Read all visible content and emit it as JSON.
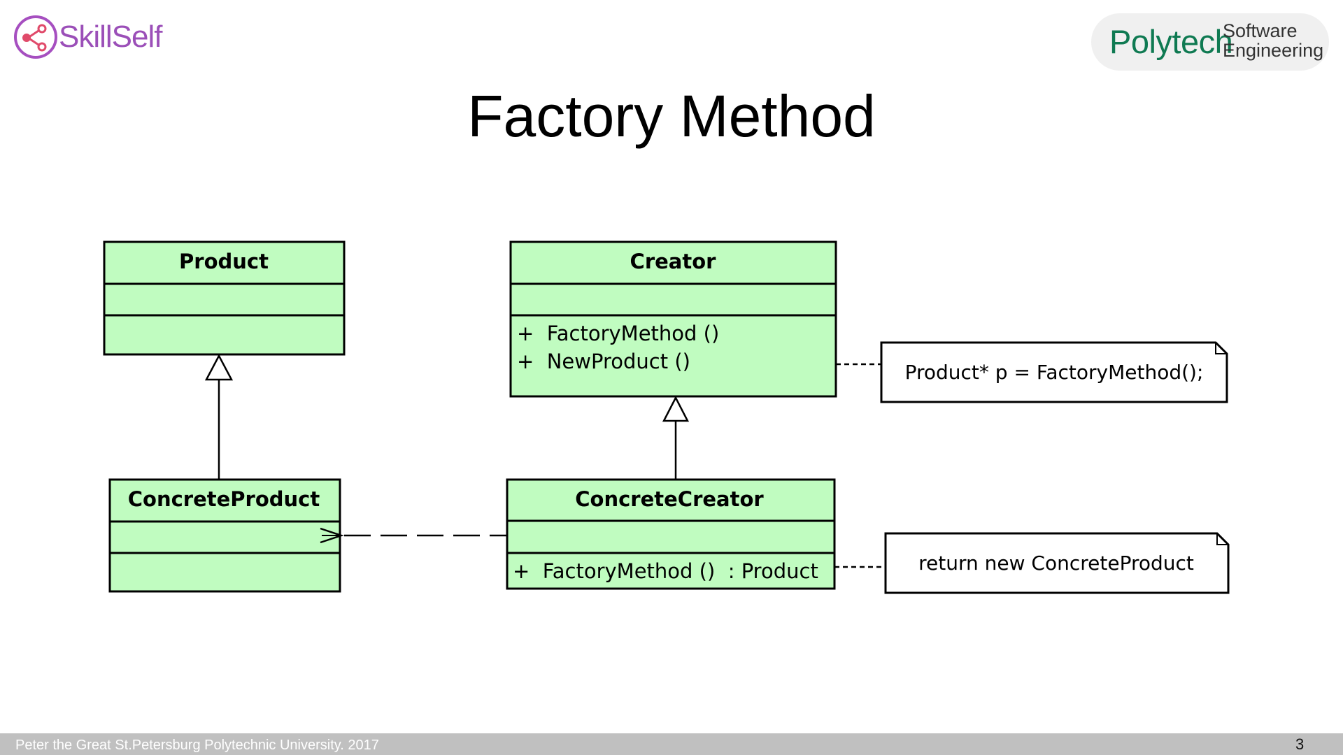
{
  "header": {
    "brand_logo": {
      "icon": "share-icon",
      "text": "SkillSelf",
      "color": "#9b4fb8"
    },
    "partner_logo": {
      "main": "Polytech",
      "sub_line1": "Software",
      "sub_line2": "Engineering",
      "color": "#0f7a52"
    }
  },
  "slide": {
    "title": "Factory Method",
    "page_number": "3"
  },
  "footer": {
    "text": "Peter the Great St.Petersburg Polytechnic University. 2017"
  },
  "diagram": {
    "class_fill": "#c0fcc0",
    "classes": [
      {
        "id": "product",
        "name": "Product",
        "attributes": [],
        "operations": []
      },
      {
        "id": "creator",
        "name": "Creator",
        "attributes": [],
        "operations": [
          "+  FactoryMethod ()",
          "+  NewProduct ()"
        ]
      },
      {
        "id": "concrete_product",
        "name": "ConcreteProduct",
        "attributes": [],
        "operations": []
      },
      {
        "id": "concrete_creator",
        "name": "ConcreteCreator",
        "attributes": [],
        "operations": [
          "+  FactoryMethod ()  : Product"
        ]
      }
    ],
    "notes": [
      {
        "id": "note_creator",
        "text": "Product* p = FactoryMethod();",
        "attached_to": "creator"
      },
      {
        "id": "note_concrete_creator",
        "text": "return new ConcreteProduct",
        "attached_to": "concrete_creator"
      }
    ],
    "relations": [
      {
        "type": "generalization",
        "from": "concrete_product",
        "to": "product"
      },
      {
        "type": "generalization",
        "from": "concrete_creator",
        "to": "creator"
      },
      {
        "type": "dependency",
        "from": "concrete_creator",
        "to": "concrete_product"
      }
    ]
  }
}
